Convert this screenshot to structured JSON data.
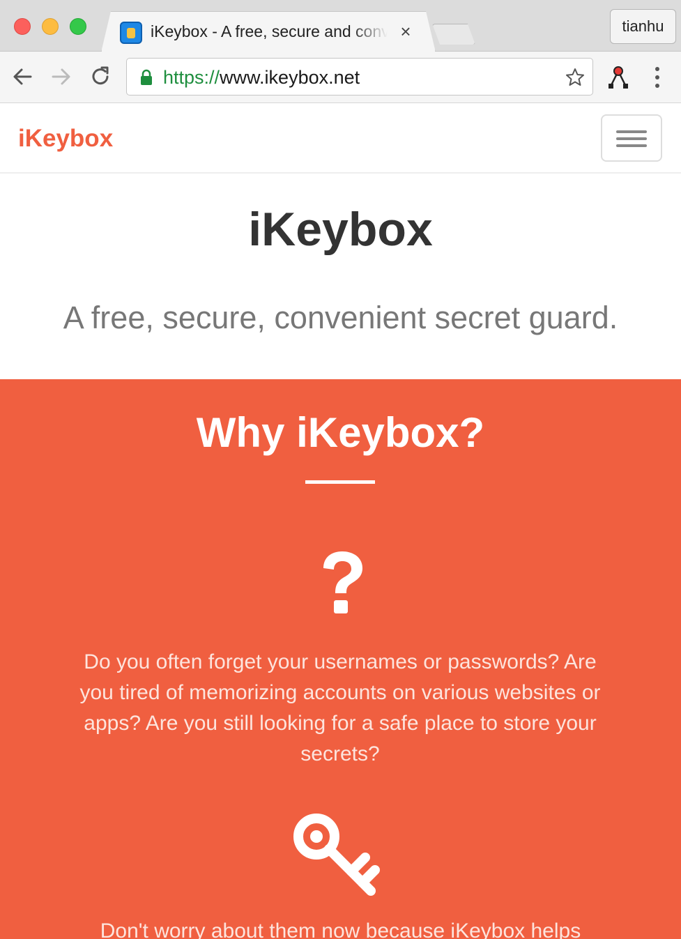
{
  "browser": {
    "tab_title": "iKeybox - A free, secure and convenient secret guard",
    "tab_close": "×",
    "profile_name": "tianhu",
    "url_scheme": "https://",
    "url_host": "www.ikeybox.net"
  },
  "navbar": {
    "brand": "iKeybox",
    "brand_color": "#f05f40"
  },
  "hero": {
    "title": "iKeybox",
    "subtitle": "A free, secure, convenient secret guard."
  },
  "why": {
    "title": "Why iKeybox?",
    "background_color": "#f05f40",
    "question_icon": "question-icon",
    "paragraph_1": "Do you often forget your usernames or passwords? Are you tired of memorizing accounts on various websites or apps? Are you still looking for a safe place to store your secrets?",
    "key_icon": "key-icon",
    "paragraph_2": "Don't worry about them now because iKeybox helps"
  }
}
